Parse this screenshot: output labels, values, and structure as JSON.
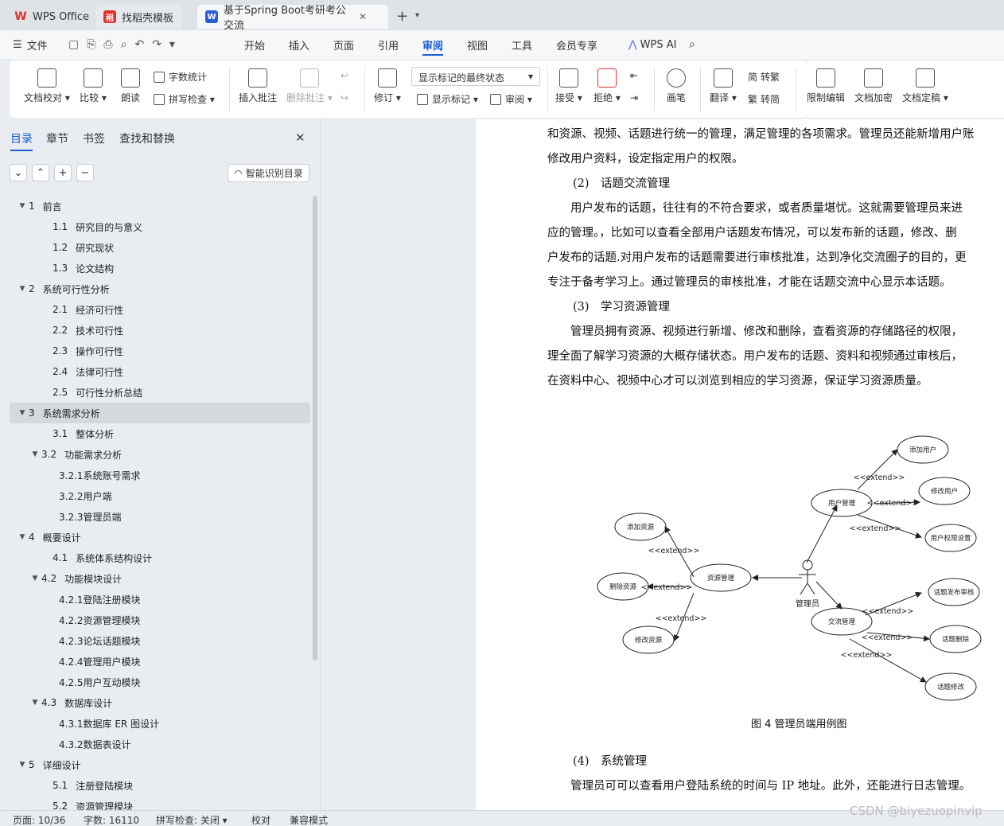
{
  "tabs": [
    {
      "label": "WPS Office"
    },
    {
      "label": "找稻壳模板"
    },
    {
      "label": "基于Spring Boot考研考公交流"
    }
  ],
  "menu": {
    "file": "文件",
    "items": [
      "开始",
      "插入",
      "页面",
      "引用",
      "审阅",
      "视图",
      "工具",
      "会员专享"
    ],
    "wps_ai": "WPS AI"
  },
  "ribbon": {
    "doc_check": "文档校对",
    "compare": "比较",
    "read": "朗读",
    "word_count": "字数统计",
    "spell_check": "拼写检查",
    "insert_comment": "插入批注",
    "delete_comment": "删除批注",
    "track": "修订",
    "show_mode": "显示标记的最终状态",
    "show_marks": "显示标记",
    "review": "审阅",
    "accept": "接受",
    "reject": "拒绝",
    "pen": "画笔",
    "translate": "翻译",
    "to_trad": "转繁",
    "to_simp": "转简",
    "restrict": "限制编辑",
    "encrypt": "文档加密",
    "finalize": "文档定稿"
  },
  "sidebar": {
    "tabs": [
      "目录",
      "章节",
      "书签",
      "查找和替换"
    ],
    "smart_btn": "智能识别目录",
    "toc": [
      {
        "n": "1",
        "t": "前言",
        "lvl": 1,
        "exp": true
      },
      {
        "n": "1.1",
        "t": "研究目的与意义",
        "lvl": 2
      },
      {
        "n": "1.2",
        "t": "研究现状",
        "lvl": 2
      },
      {
        "n": "1.3",
        "t": "论文结构",
        "lvl": 2
      },
      {
        "n": "2",
        "t": "系统可行性分析",
        "lvl": 1,
        "exp": true
      },
      {
        "n": "2.1",
        "t": "经济可行性",
        "lvl": 2
      },
      {
        "n": "2.2",
        "t": "技术可行性",
        "lvl": 2
      },
      {
        "n": "2.3",
        "t": "操作可行性",
        "lvl": 2
      },
      {
        "n": "2.4",
        "t": "法律可行性",
        "lvl": 2
      },
      {
        "n": "2.5",
        "t": "可行性分析总结",
        "lvl": 2
      },
      {
        "n": "3",
        "t": "系统需求分析",
        "lvl": 1,
        "exp": true,
        "sel": true
      },
      {
        "n": "3.1",
        "t": "整体分析",
        "lvl": 2
      },
      {
        "n": "3.2",
        "t": "功能需求分析",
        "lvl": 2,
        "exp": true
      },
      {
        "n": "",
        "t": "3.2.1系统账号需求",
        "lvl": 3
      },
      {
        "n": "",
        "t": "3.2.2用户端",
        "lvl": 3
      },
      {
        "n": "",
        "t": "3.2.3管理员端",
        "lvl": 3
      },
      {
        "n": "4",
        "t": "概要设计",
        "lvl": 1,
        "exp": true
      },
      {
        "n": "4.1",
        "t": "系统体系结构设计",
        "lvl": 2
      },
      {
        "n": "4.2",
        "t": "功能模块设计",
        "lvl": 2,
        "exp": true
      },
      {
        "n": "",
        "t": "4.2.1登陆注册模块",
        "lvl": 3
      },
      {
        "n": "",
        "t": "4.2.2资源管理模块",
        "lvl": 3
      },
      {
        "n": "",
        "t": "4.2.3论坛话题模块",
        "lvl": 3
      },
      {
        "n": "",
        "t": "4.2.4管理用户模块",
        "lvl": 3
      },
      {
        "n": "",
        "t": "4.2.5用户互动模块",
        "lvl": 3
      },
      {
        "n": "4.3",
        "t": "数据库设计",
        "lvl": 2,
        "exp": true
      },
      {
        "n": "",
        "t": "4.3.1数据库 ER 图设计",
        "lvl": 3
      },
      {
        "n": "",
        "t": "4.3.2数据表设计",
        "lvl": 3
      },
      {
        "n": "5",
        "t": "详细设计",
        "lvl": 1,
        "exp": true
      },
      {
        "n": "5.1",
        "t": "注册登陆模块",
        "lvl": 2
      },
      {
        "n": "5.2",
        "t": "资源管理模块",
        "lvl": 2
      }
    ]
  },
  "doc": {
    "lines": [
      "和资源、视频、话题进行统一的管理，满足管理的各项需求。管理员还能新增用户账",
      "修改用户资料，设定指定用户的权限。",
      "(2)　话题交流管理",
      "　　用户发布的话题，往往有的不符合要求，或者质量堪忧。这就需要管理员来进",
      "应的管理。，比如可以查看全部用户话题发布情况，可以发布新的话题，修改、删",
      "户发布的话题.对用户发布的话题需要进行审核批准，达到净化交流圈子的目的，更",
      "专注于备考学习上。通过管理员的审核批准，才能在话题交流中心显示本话题。",
      "(3)　学习资源管理",
      "　　管理员拥有资源、视频进行新增、修改和删除，查看资源的存储路径的权限，",
      "理全面了解学习资源的大概存储状态。用户发布的话题、资料和视频通过审核后，",
      "在资料中心、视频中心才可以浏览到相应的学习资源，保证学习资源质量。"
    ],
    "caption": "图 4  管理员端用例图",
    "after": [
      "(4)　系统管理",
      "　　管理员可可以查看用户登陆系统的时间与 IP 地址。此外，还能进行日志管理。"
    ]
  },
  "diagram": {
    "actor": "管理员",
    "extend": "<<extend>>",
    "nodes": {
      "res": "资源管理",
      "user": "用户管理",
      "ex": "交流管理",
      "addres": "添加资源",
      "delres": "删除资源",
      "modres": "修改资源",
      "adduser": "添加用户",
      "moduser": "修改用户",
      "perm": "用户权限设置",
      "pub": "话题发布审核",
      "del": "话题删除",
      "mod": "话题修改"
    }
  },
  "status": {
    "page": "页面: 10/36",
    "words": "字数: 16110",
    "spell": "拼写检查: 关闭",
    "proof": "校对",
    "compat": "兼容模式"
  },
  "watermark": "CSDN @biyezuopinvip"
}
